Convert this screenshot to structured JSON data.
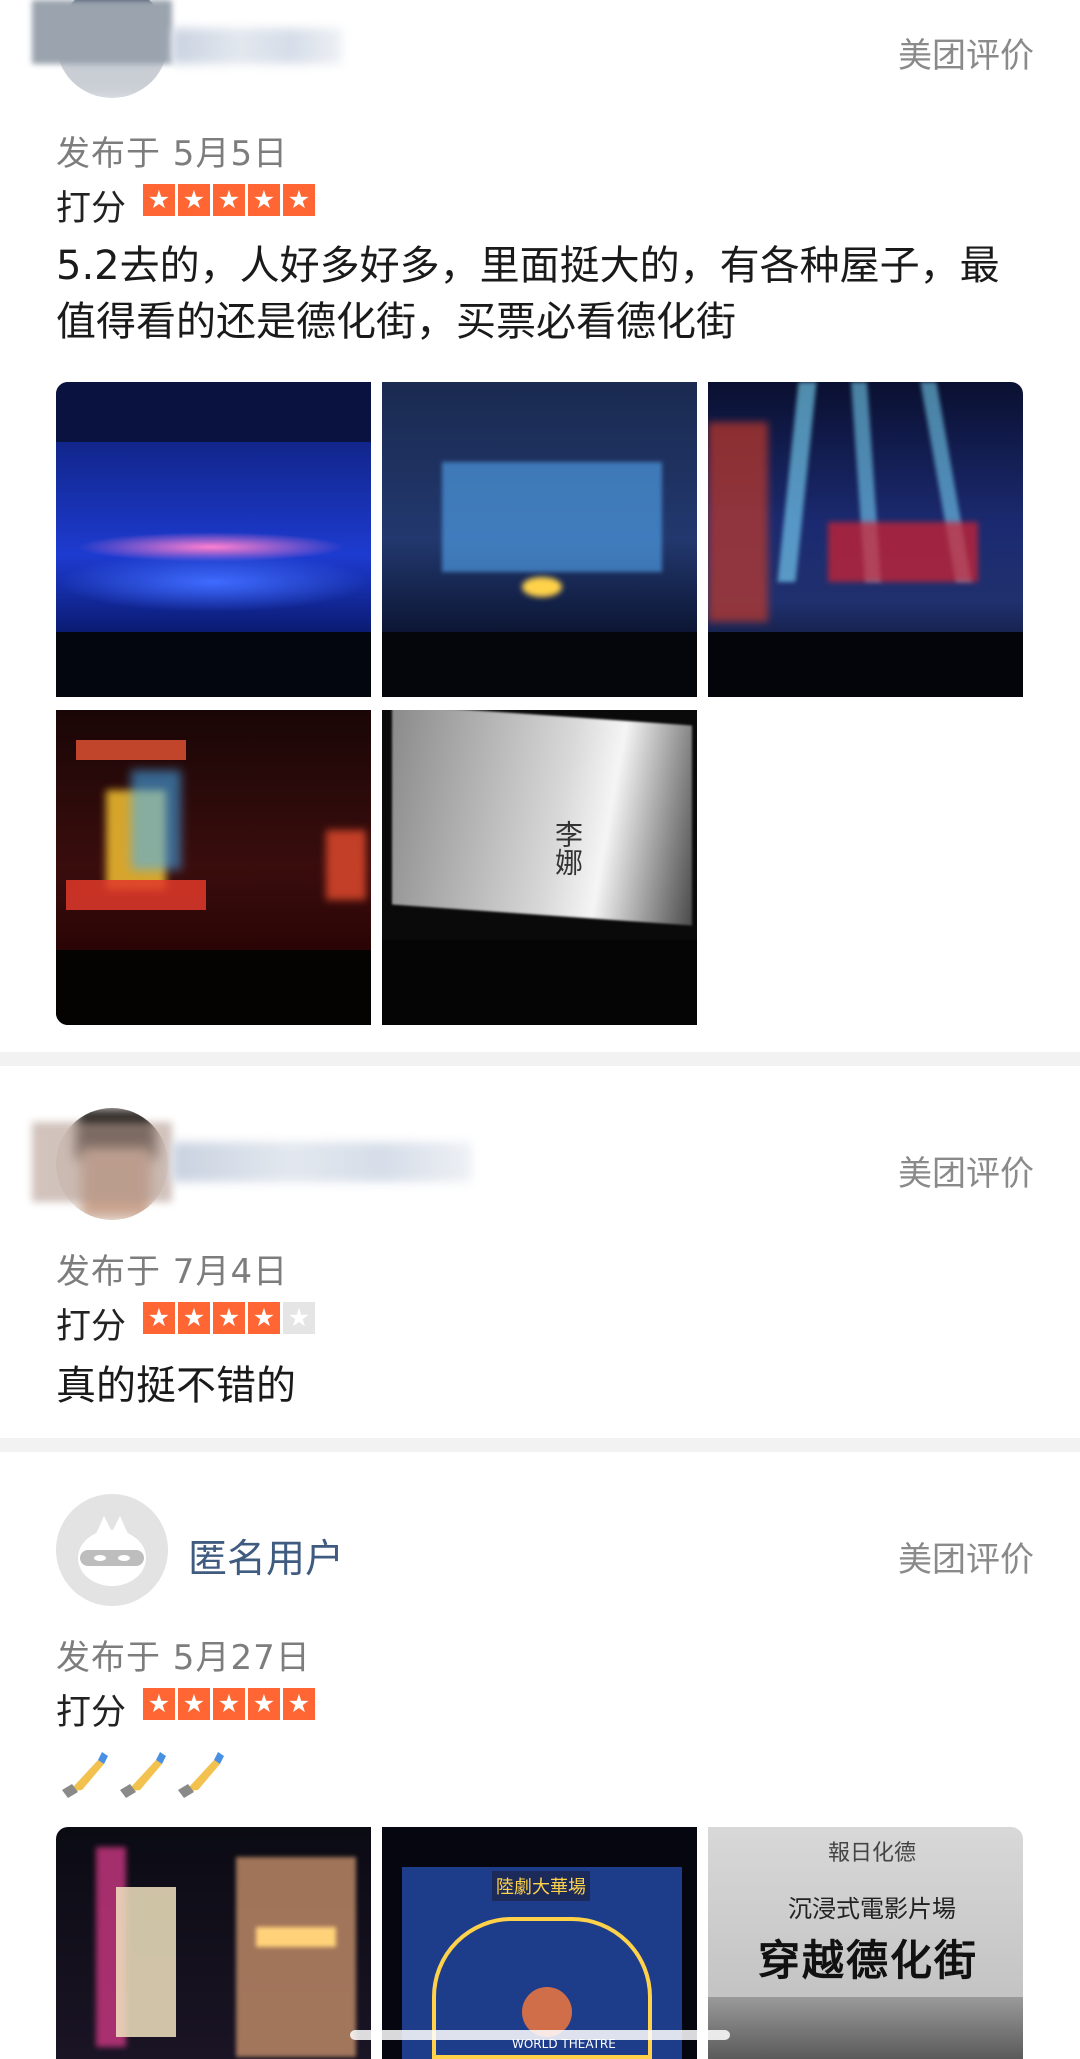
{
  "reviews": [
    {
      "source": "美团评价",
      "date": "发布于 5月5日",
      "score_label": "打分",
      "rating": 5,
      "text": "5.2去的，人好多好多，里面挺大的，有各种屋子，最值得看的还是德化街，买票必看德化街",
      "photo_icons": [
        "stage-dance-photo",
        "stage-blue-set-photo",
        "stage-spotlight-photo",
        "stage-red-gate-photo",
        "projection-wall-photo"
      ],
      "projection_text": "李娜"
    },
    {
      "source": "美团评价",
      "date": "发布于 7月4日",
      "score_label": "打分",
      "rating": 4,
      "text": "真的挺不错的"
    },
    {
      "user": "匿名用户",
      "source": "美团评价",
      "date": "发布于 5月27日",
      "score_label": "打分",
      "rating": 5,
      "emoji_icons": [
        "thumbs-hand-icon",
        "thumbs-hand-icon",
        "thumbs-hand-icon"
      ],
      "photo3_title": "穿越德化街",
      "photo3_subtitle": "沉浸式電影片場",
      "photo3_header": "報日化德",
      "photo2_sign": "陸劇大華場",
      "photo2_banner": "WORLD THEATRE"
    }
  ],
  "colors": {
    "star": "#ff6633",
    "star_off": "#e5e5e5",
    "separator": "#f2f2f2",
    "username": "#3f5c80"
  }
}
